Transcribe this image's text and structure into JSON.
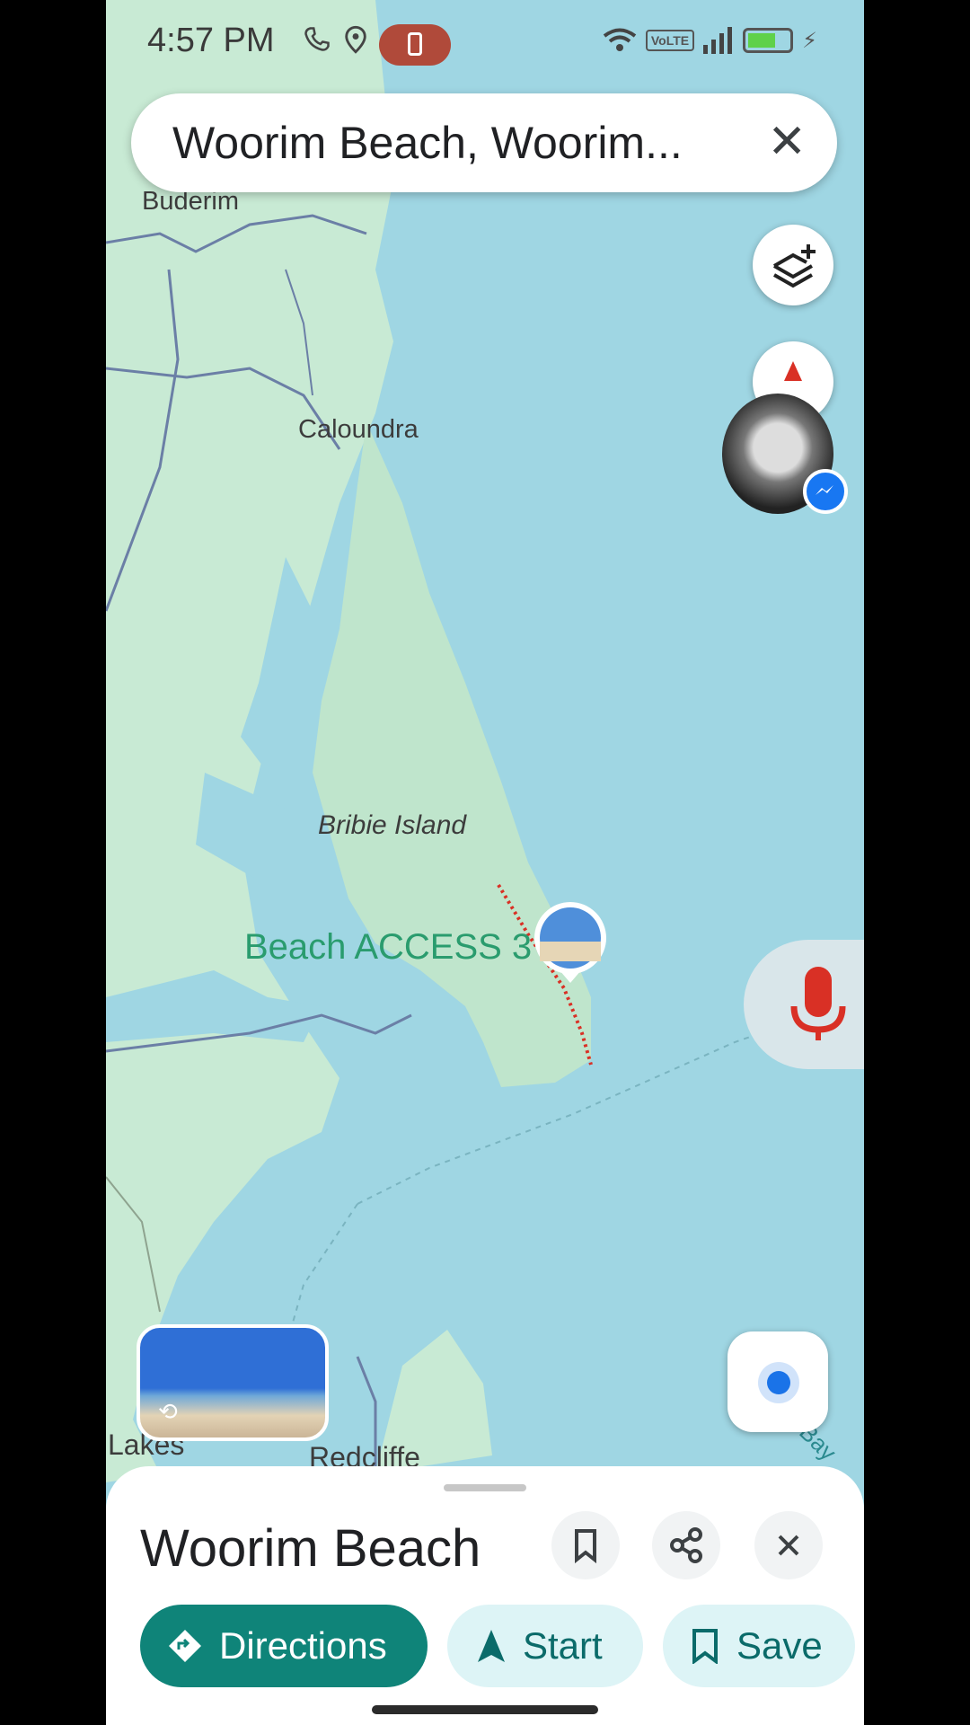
{
  "status_bar": {
    "time": "4:57 PM",
    "network_label": "VoLTE"
  },
  "search": {
    "query": "Woorim Beach, Woorim..."
  },
  "map": {
    "labels": {
      "buderim": "Buderim",
      "caloundra": "Caloundra",
      "bribie": "Bribie Island",
      "beach_access": "Beach ACCESS 3",
      "lakes": "Lakes",
      "redcliffe": "Redcliffe",
      "bay": "Bay"
    }
  },
  "place_sheet": {
    "title": "Woorim Beach",
    "actions": {
      "directions": "Directions",
      "start": "Start",
      "save": "Save"
    }
  },
  "icons": [
    "phone-icon",
    "location-icon",
    "wifi-icon",
    "signal-icon",
    "battery-icon",
    "layers-icon",
    "compass-icon",
    "messenger-icon",
    "mic-icon",
    "my-location-icon",
    "bookmark-icon",
    "share-icon",
    "close-icon",
    "directions-icon",
    "navigation-icon"
  ],
  "colors": {
    "water": "#9fd6e3",
    "land": "#c8ead4",
    "primary": "#0f8479",
    "accent_red": "#d93025"
  }
}
